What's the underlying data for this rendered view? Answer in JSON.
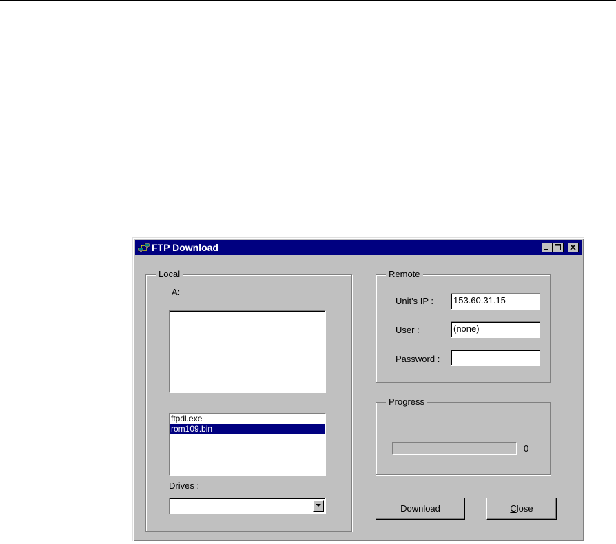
{
  "window": {
    "title": "FTP Download"
  },
  "local": {
    "group_label": "Local",
    "current_dir": "A:",
    "files": [
      "ftpdl.exe",
      "rom109.bin"
    ],
    "selected_file_index": 1,
    "drives_label": "Drives :",
    "drive_value": ""
  },
  "remote": {
    "group_label": "Remote",
    "ip_label": "Unit's IP :",
    "ip_value": "153.60.31.15",
    "user_label": "User :",
    "user_value": "(none)",
    "password_label": "Password :",
    "password_value": ""
  },
  "progress": {
    "group_label": "Progress",
    "value": 0,
    "value_text": "0"
  },
  "buttons": {
    "download_label": "Download",
    "close_label_first": "C",
    "close_label_rest": "lose"
  }
}
